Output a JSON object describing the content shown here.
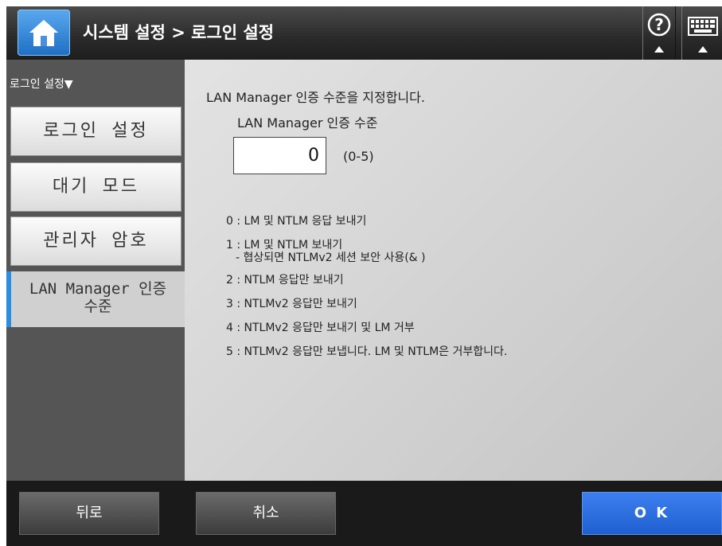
{
  "header": {
    "title": "시스템 설정 > 로그인 설정",
    "home_icon": "home-icon",
    "help_icon": "help-icon",
    "keyboard_icon": "keyboard-icon",
    "accent_color": "#2a8ee0"
  },
  "sidebar": {
    "breadcrumb": "로그인 설정▼",
    "items": [
      {
        "label": "로그인 설정"
      },
      {
        "label": "대기 모드"
      },
      {
        "label": "관리자 암호"
      }
    ],
    "active_item": {
      "line1": "LAN Manager 인증",
      "line2": "수준"
    }
  },
  "main": {
    "description": "LAN Manager 인증 수준을 지정합니다.",
    "field_label": "LAN Manager 인증 수준",
    "field_value": "0",
    "range_hint": "(0-5)",
    "options": [
      {
        "text": "0 : LM 및 NTLM 응답 보내기"
      },
      {
        "text": "1 : LM 및 NTLM 보내기",
        "sub": "- 협상되면 NTLMv2 세션 보안 사용(& )"
      },
      {
        "text": "2 : NTLM 응답만 보내기"
      },
      {
        "text": "3 : NTLMv2 응답만 보내기"
      },
      {
        "text": "4 : NTLMv2 응답만 보내기 및 LM 거부"
      },
      {
        "text": "5 : NTLMv2 응답만 보냅니다. LM 및 NTLM은 거부합니다."
      }
    ]
  },
  "footer": {
    "back_label": "뒤로",
    "cancel_label": "취소",
    "ok_label": "O K"
  }
}
